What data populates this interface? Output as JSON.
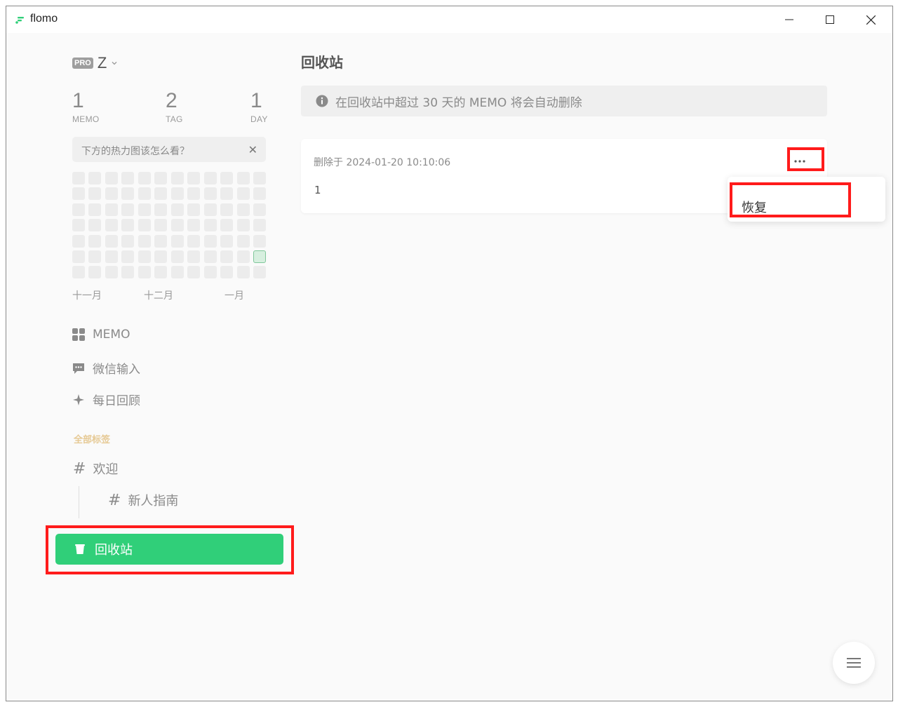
{
  "window": {
    "title": "flomo"
  },
  "user": {
    "badge": "PRO",
    "name": "Z"
  },
  "stats": [
    {
      "num": "1",
      "label": "MEMO"
    },
    {
      "num": "2",
      "label": "TAG"
    },
    {
      "num": "1",
      "label": "DAY"
    }
  ],
  "heatmap": {
    "hint": "下方的热力图该怎么看？",
    "months": [
      "十一月",
      "十二月",
      "一月"
    ],
    "active_cells": 1
  },
  "nav": {
    "memo": "MEMO",
    "wechat": "微信输入",
    "review": "每日回顾"
  },
  "tags": {
    "header": "全部标签",
    "items": [
      "欢迎",
      "新人指南"
    ]
  },
  "trash_button": "回收站",
  "main": {
    "title": "回收站",
    "notice": "在回收站中超过 30 天的 MEMO 将会自动删除",
    "memo": {
      "meta": "删除于 2024-01-20 10:10:06",
      "content": "1"
    },
    "menu": {
      "restore": "恢复"
    }
  },
  "colors": {
    "accent": "#30cf79",
    "highlight": "#ff1b1b"
  }
}
